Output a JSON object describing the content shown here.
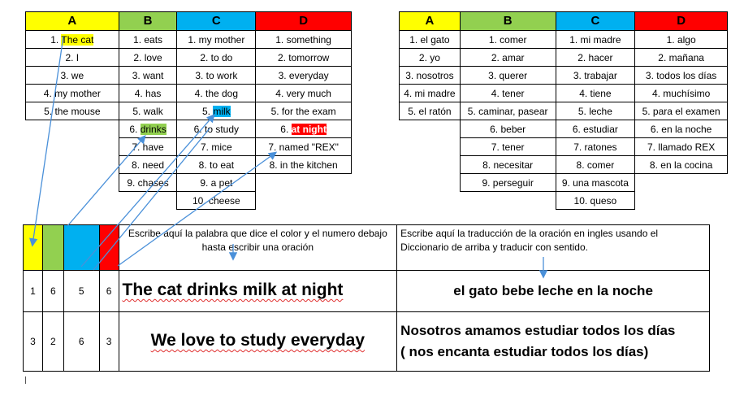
{
  "english_dictionary": {
    "headers": [
      "A",
      "B",
      "C",
      "D"
    ],
    "col_a": [
      "1. The cat",
      "2. I",
      "3. we",
      "4. my mother",
      "5. the mouse"
    ],
    "col_b": [
      "1. eats",
      "2. love",
      "3. want",
      "4. has",
      "5. walk",
      "6. drinks",
      "7. have",
      "8. need",
      "9. chases"
    ],
    "col_c": [
      "1. my mother",
      "2. to do",
      "3. to work",
      "4. the dog",
      "5. milk",
      "6. to study",
      "7. mice",
      "8. to eat",
      "9.  a pet",
      "10. cheese"
    ],
    "col_d": [
      "1.  something",
      "2. tomorrow",
      "3. everyday",
      "4. very much",
      "5. for the exam",
      "6. at night",
      "7. named \"REX\"",
      "8. in the kitchen"
    ],
    "highlight_parts": {
      "a1_prefix": "1. ",
      "a1_word": "The cat",
      "b6_prefix": "6. ",
      "b6_word": "drinks",
      "c5_prefix": "5. ",
      "c5_word": "milk",
      "d6_prefix": "6. ",
      "d6_word": "at night"
    }
  },
  "spanish_dictionary": {
    "headers": [
      "A",
      "B",
      "C",
      "D"
    ],
    "col_a": [
      "1. el gato",
      "2. yo",
      "3. nosotros",
      "4. mi madre",
      "5. el ratón"
    ],
    "col_b": [
      "1. comer",
      "2. amar",
      "3. querer",
      "4. tener",
      "5. caminar, pasear",
      "6. beber",
      "7. tener",
      "8. necesitar",
      "9. perseguir"
    ],
    "col_c": [
      "1. mi madre",
      "2. hacer",
      "3. trabajar",
      "4. tiene",
      "5. leche",
      "6.  estudiar",
      "7.  ratones",
      "8. comer",
      "9. una mascota",
      "10. queso"
    ],
    "col_d": [
      "1. algo",
      "2. mañana",
      "3. todos los días",
      "4. muchísimo",
      "5. para el examen",
      "6. en la noche",
      "7. llamado REX",
      "8. en la cocina"
    ]
  },
  "worksheet": {
    "instruction_left": "Escribe aquí la palabra que dice el color y el numero debajo hasta escribir una oración",
    "instruction_right": "Escribe aquí la traducción de la oración en ingles usando el Diccionario de arriba y traducir con sentido.",
    "rows": [
      {
        "a": "1",
        "b": "6",
        "c": "5",
        "d": "6",
        "sentence": "The cat drinks milk at night",
        "translation_line1": "el gato bebe leche en la noche",
        "translation_line2": ""
      },
      {
        "a": "3",
        "b": "2",
        "c": "6",
        "d": "3",
        "sentence": "We love to study everyday",
        "translation_line1": "Nosotros amamos estudiar todos los días",
        "translation_line2": "( nos encanta estudiar todos los días)"
      }
    ]
  },
  "colors": {
    "yellow": "#ffff00",
    "green": "#92d050",
    "blue": "#00b0f0",
    "red": "#ff0000",
    "arrow": "#4a90d9",
    "spell_underline": "#e03030"
  }
}
